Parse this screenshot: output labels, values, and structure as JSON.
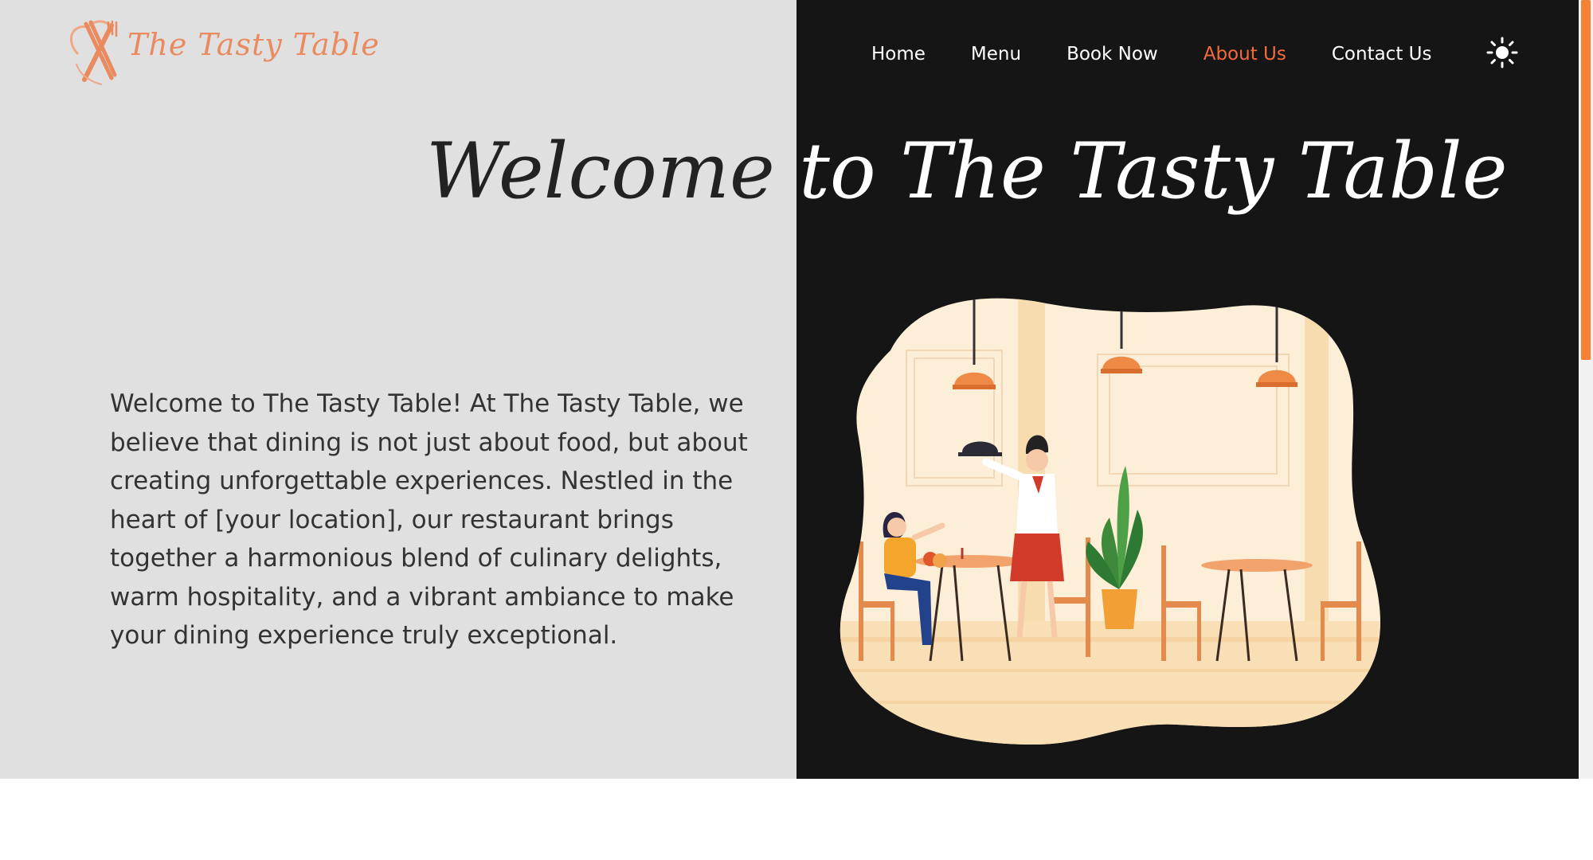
{
  "brand": {
    "logo_text": "The Tasty Table"
  },
  "nav": {
    "items": [
      {
        "label": "Home"
      },
      {
        "label": "Menu"
      },
      {
        "label": "Book Now"
      },
      {
        "label": "About Us"
      },
      {
        "label": "Contact Us"
      }
    ],
    "active": "About Us",
    "theme_toggle_icon": "sun-icon"
  },
  "hero": {
    "title": "Welcome to The Tasty Table"
  },
  "about": {
    "paragraph": "Welcome to The Tasty Table! At The Tasty Table, we believe that dining is not just about food, but about creating unforgettable experiences. Nestled in the heart of [your location], our restaurant brings together a harmonious blend of culinary delights, warm hospitality, and a vibrant ambiance to make your dining experience truly exceptional."
  },
  "colors": {
    "accent": "#f26b3a",
    "left_background": "#e0e0e0",
    "right_background": "#151515",
    "scroll_thumb": "#f58233"
  }
}
